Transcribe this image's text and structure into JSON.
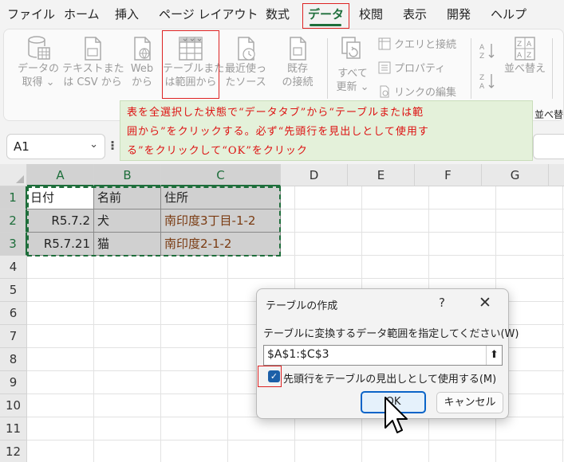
{
  "menu": {
    "tabs": [
      "ファイル",
      "ホーム",
      "挿入",
      "ページ レイアウト",
      "数式",
      "データ",
      "校閲",
      "表示",
      "開発",
      "ヘルプ"
    ],
    "active": "データ"
  },
  "ribbon": {
    "get_data": [
      "データの",
      "取得 ⌄"
    ],
    "from_text_csv": [
      "テキストまた",
      "は CSV から"
    ],
    "from_web": [
      "Web",
      "から"
    ],
    "from_table_range": [
      "テーブルまた",
      "は範囲から"
    ],
    "recent_sources": [
      "最近使っ",
      "たソース"
    ],
    "existing_connections": [
      "既存",
      "の接続"
    ],
    "refresh_all": [
      "すべて",
      "更新 ⌄"
    ],
    "queries_connections": "クエリと接続",
    "properties": "プロパティ",
    "edit_links": "リンクの編集",
    "sort": "並べ替え",
    "cut_label": "並べ替"
  },
  "annotation": {
    "lines": [
      "表を全選択した状態で“データタブ”から“テーブルまたは範",
      "囲から”をクリックする。必ず“先頭行を見出しとして使用す",
      "る”をクリックして“OK”をクリック"
    ]
  },
  "namebox": {
    "value": "A1",
    "fx": "⁝"
  },
  "sheet": {
    "columns": [
      "A",
      "B",
      "C",
      "D",
      "E",
      "F",
      "G"
    ],
    "rows": [
      "1",
      "2",
      "3",
      "4",
      "5",
      "6",
      "7",
      "8",
      "9",
      "10",
      "11",
      "12"
    ],
    "cells": {
      "a1": "日付",
      "b1": "名前",
      "c1": "住所",
      "a2": "R5.7.2",
      "b2": "犬",
      "c2": "南印度3丁目-1-2",
      "a3": "R5.7.21",
      "b3": "猫",
      "c3": "南印度2-1-2"
    }
  },
  "dialog": {
    "title": "テーブルの作成",
    "help": "?",
    "close": "✕",
    "prompt": "テーブルに変換するデータ範囲を指定してください(W)",
    "range_value": "$A$1:$C$3",
    "collapse": "⬆",
    "checkbox_checked": true,
    "checkbox_mark": "✓",
    "checkbox_label": "先頭行をテーブルの見出しとして使用する(M)",
    "ok": "OK",
    "cancel": "キャンセル"
  },
  "colors": {
    "accent_green": "#1e6e3b",
    "annotation_red": "#d11",
    "ok_blue": "#0a64c8"
  }
}
